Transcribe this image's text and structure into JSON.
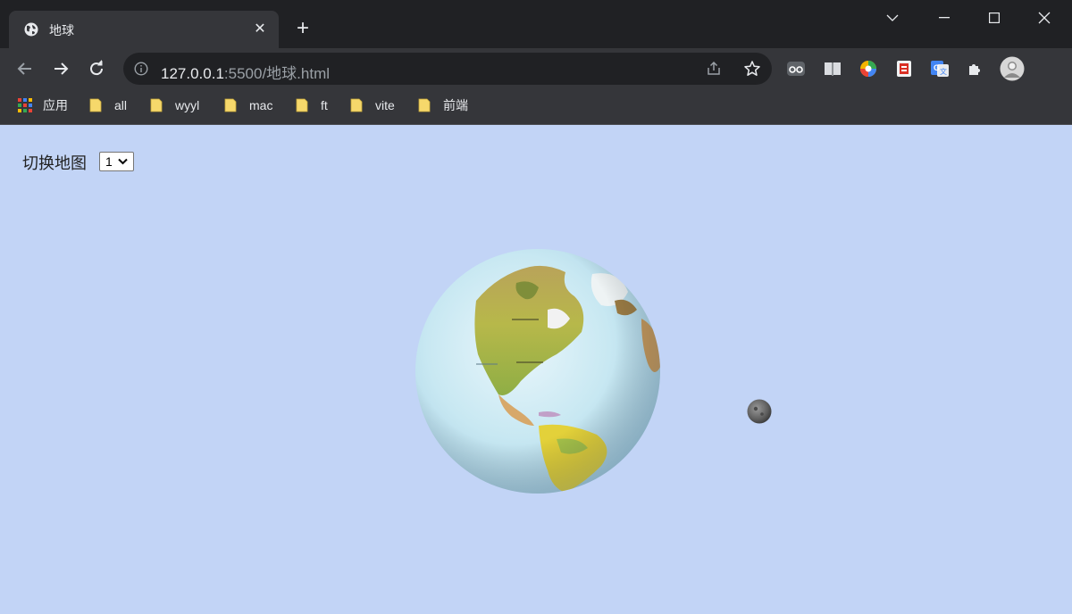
{
  "tab": {
    "title": "地球",
    "favicon": "globe-icon",
    "close_glyph": "✕"
  },
  "new_tab_glyph": "+",
  "toolbar": {
    "url_host": "127.0.0.1",
    "url_rest": ":5500/地球.html"
  },
  "bookmarks": [
    {
      "label": "应用",
      "icon": "apps-grid-icon"
    },
    {
      "label": "all",
      "icon": "folder-icon"
    },
    {
      "label": "wyyl",
      "icon": "folder-icon"
    },
    {
      "label": "mac",
      "icon": "folder-icon"
    },
    {
      "label": "ft",
      "icon": "folder-icon"
    },
    {
      "label": "vite",
      "icon": "folder-icon"
    },
    {
      "label": "前端",
      "icon": "folder-icon"
    }
  ],
  "page": {
    "switch_label": "切换地图",
    "map_select_value": "1",
    "background": "#c2d4f6"
  },
  "colors": {
    "titlebar": "#202124",
    "toolbar": "#35363a",
    "text": "#e8eaed",
    "folder": "#f6d86b"
  }
}
